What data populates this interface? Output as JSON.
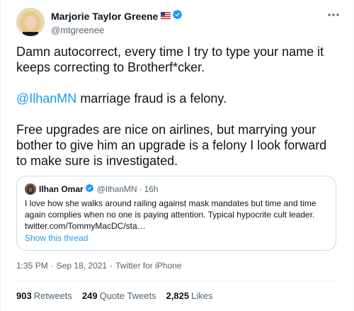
{
  "author": {
    "display_name": "Marjorie Taylor Greene",
    "handle": "@mtgreenee",
    "flag_icon": "us-flag-icon",
    "verified_icon": "verified-badge-icon"
  },
  "tweet": {
    "line1": "Damn autocorrect, every time I try to type your name it keeps correcting to Brotherf*cker.",
    "mention": "@IlhanMN",
    "line2_rest": " marriage fraud is a felony.",
    "line3": "Free upgrades are nice on airlines, but marrying your bother to give him an upgrade is a felony I look forward to make sure is investigated."
  },
  "quote": {
    "display_name": "Ilhan Omar",
    "handle": "@IlhanMN",
    "separator": "·",
    "time": "16h",
    "text": "I love how she walks around railing against mask mandates but time and time again complies when no one is paying attention. Typical hypocrite cult leader. twitter.com/TommyMacDC/sta…",
    "show_thread": "Show this thread"
  },
  "meta": {
    "time": "1:35 PM",
    "dot1": "·",
    "date": "Sep 18, 2021",
    "dot2": "·",
    "source": "Twitter for iPhone"
  },
  "stats": {
    "retweets_count": "903",
    "retweets_label": "Retweets",
    "quotes_count": "249",
    "quotes_label": "Quote Tweets",
    "likes_count": "2,825",
    "likes_label": "Likes"
  },
  "colors": {
    "accent": "#1d9bf0",
    "text": "#0f1419",
    "secondary": "#536471",
    "border": "#cfd9de"
  }
}
